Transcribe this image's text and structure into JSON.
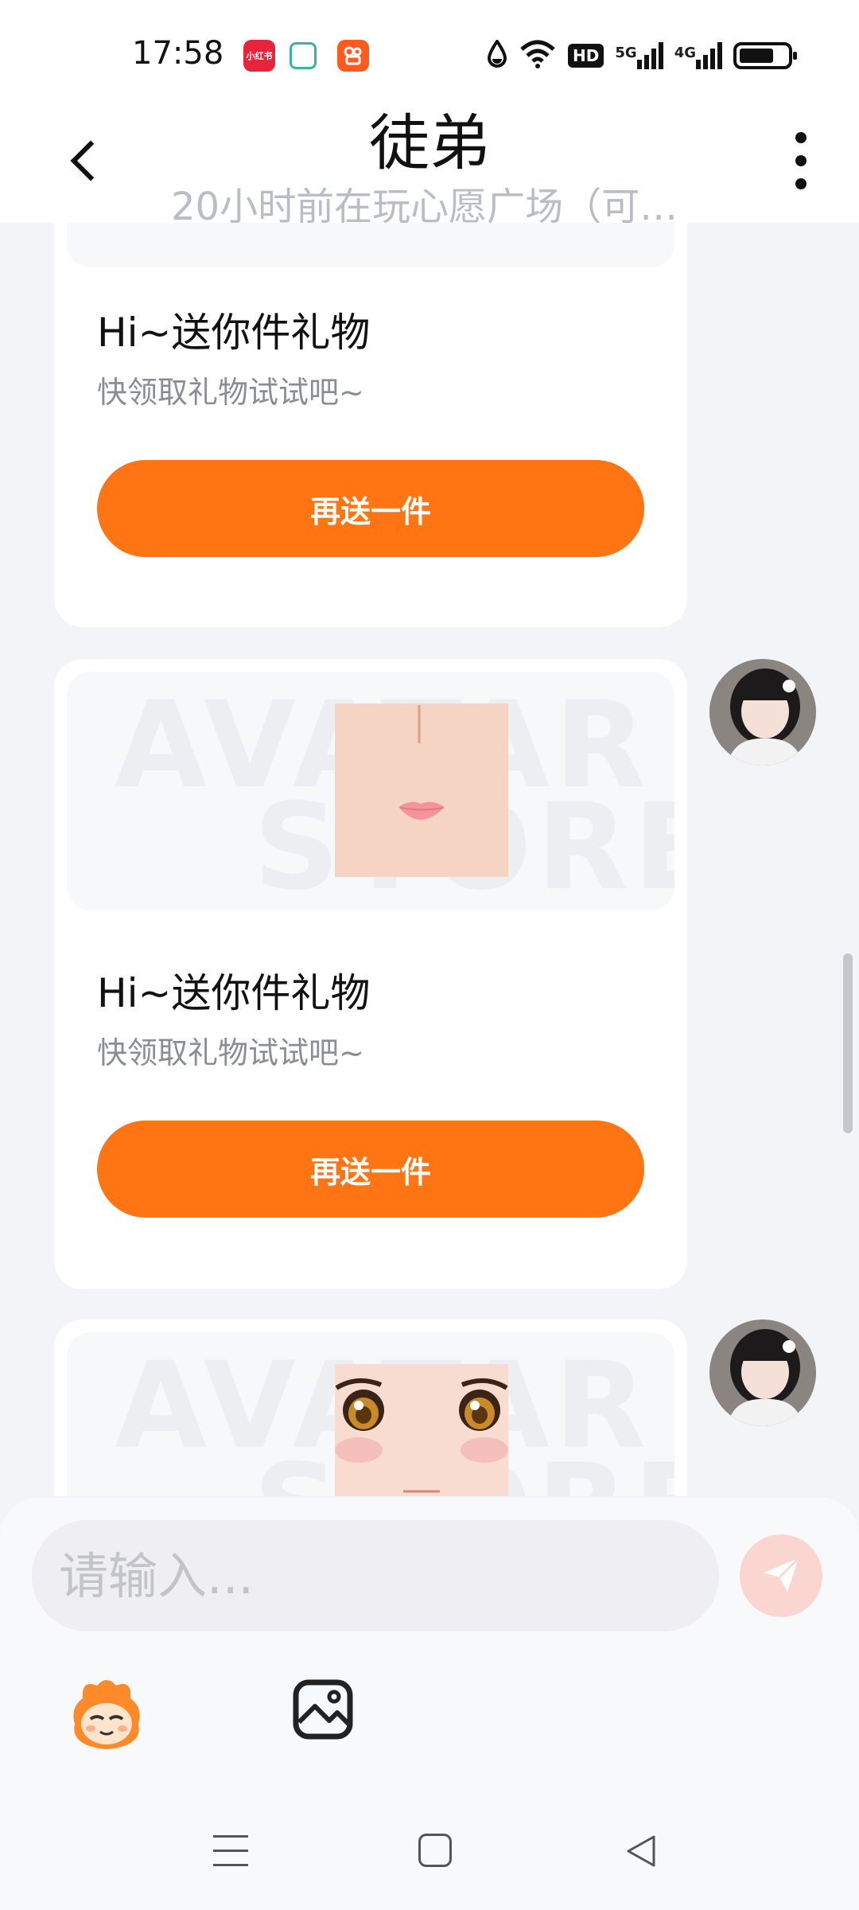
{
  "status_bar": {
    "time": "17:58",
    "apps": [
      "小红书",
      "home-app",
      "kuaishou"
    ],
    "network": [
      "HD",
      "5G",
      "4G"
    ],
    "battery_level": 0.65
  },
  "header": {
    "title": "徒弟",
    "subtitle": "20小时前在玩心愿广场（可…"
  },
  "messages": [
    {
      "title": "Hi~送你件礼物",
      "desc": "快领取礼物试试吧~",
      "button": "再送一件"
    },
    {
      "title": "Hi~送你件礼物",
      "desc": "快领取礼物试试吧~",
      "button": "再送一件",
      "watermark": "AVATAR STORE"
    },
    {
      "watermark": "AVATAR STORE"
    }
  ],
  "input": {
    "placeholder": "请输入..."
  },
  "icons": {
    "send": "send-icon",
    "mascot": "mascot-icon",
    "image": "image-icon",
    "nav": [
      "menu-icon",
      "home-icon",
      "back-icon"
    ]
  },
  "colors": {
    "accent": "#ff7514",
    "background": "#f3f4f8",
    "send_disabled": "#fbd6d0"
  }
}
